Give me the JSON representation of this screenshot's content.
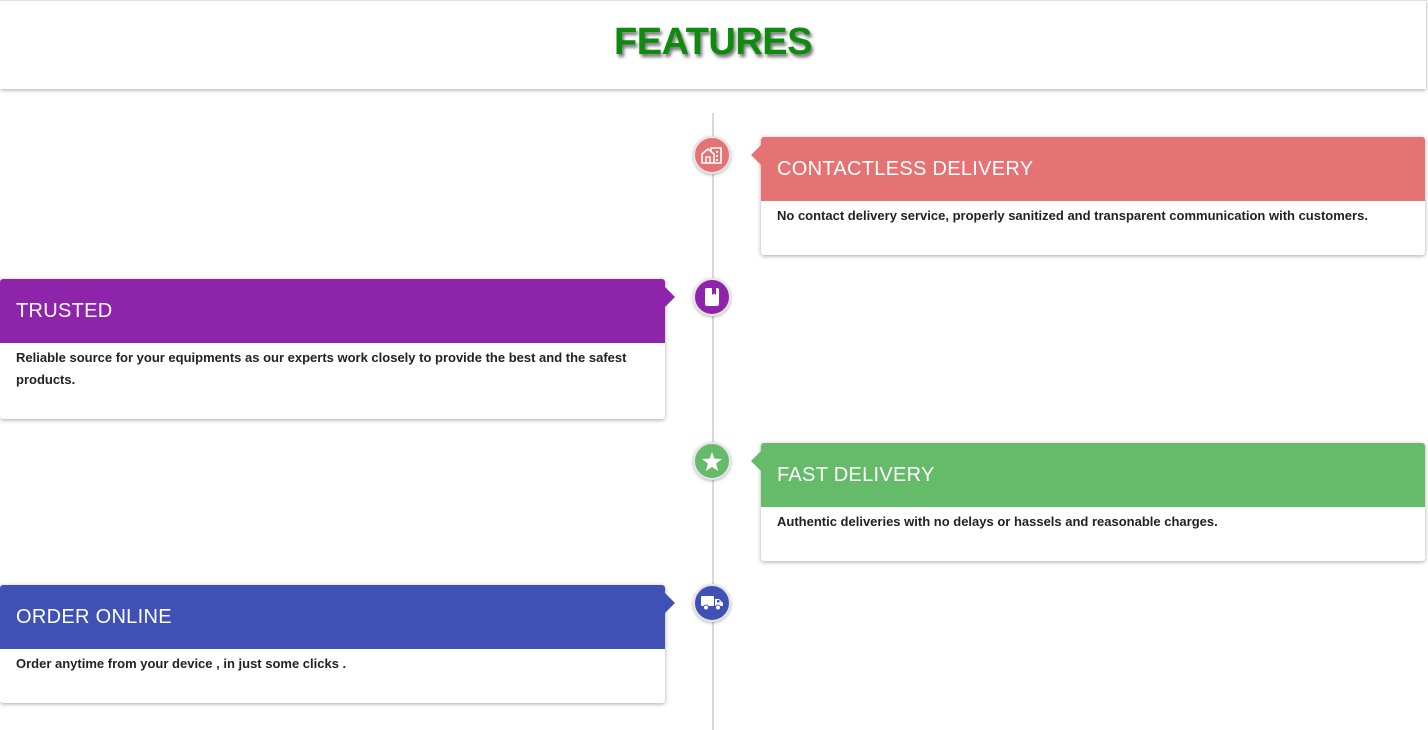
{
  "header": {
    "title": "FEATURES",
    "title_color": "#0e8a0e"
  },
  "features": [
    {
      "title": "CONTACTLESS DELIVERY",
      "description": "No contact delivery service, properly sanitized and transparent communication with customers.",
      "color": "#e57373",
      "icon": "building-icon",
      "side": "right"
    },
    {
      "title": "TRUSTED",
      "description": "Reliable source for your equipments as our experts work closely to provide the best and the safest products.",
      "color": "#8e24aa",
      "icon": "book-icon",
      "side": "left"
    },
    {
      "title": "FAST DELIVERY",
      "description": "Authentic deliveries with no delays or hassels and reasonable charges.",
      "color": "#66bb6a",
      "icon": "star-icon",
      "side": "right"
    },
    {
      "title": "ORDER ONLINE",
      "description": "Order anytime from your device , in just some clicks .",
      "color": "#3f51b5",
      "icon": "truck-icon",
      "side": "left"
    }
  ]
}
